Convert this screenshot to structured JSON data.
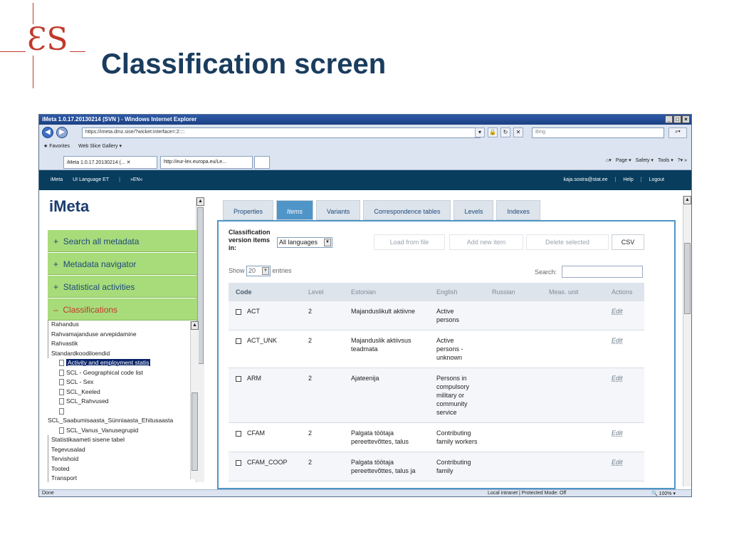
{
  "slide": {
    "title": "Classification screen"
  },
  "browser": {
    "window_title": "iMeta 1.0.17.20130214 (SVN ) - Windows Internet Explorer",
    "address": "https://imeta.dmz.sise/?wicket:interface=:2::::",
    "search_placeholder": "Bing",
    "favorites_label": "Favorites",
    "web_slice_label": "Web Slice Gallery ▾",
    "tabs": [
      "iMeta 1.0.17.20130214 (...",
      "http://eur-lex.europa.eu/Le..."
    ],
    "commands": [
      "Page ▾",
      "Safety ▾",
      "Tools ▾"
    ],
    "status_text": "Done",
    "zone_text": "Local intranet | Protected Mode: Off",
    "zoom": "100%"
  },
  "appbar": {
    "left": [
      "iMeta",
      "UI Language ET",
      "»EN«"
    ],
    "user": "kaja.sostra@stat.ee",
    "help": "Help",
    "logout": "Logout"
  },
  "sidebar": {
    "logo": "iMeta",
    "sections": [
      {
        "label": "Search all metadata",
        "symbol": "+"
      },
      {
        "label": "Metadata navigator",
        "symbol": "+"
      },
      {
        "label": "Statistical activities",
        "symbol": "+"
      },
      {
        "label": "Classifications",
        "symbol": "–"
      }
    ],
    "tree": [
      "Rahandus",
      "Rahvamajanduse arvepidamine",
      "Rahvastik",
      "Standardkoodiloendid",
      "Activity and employment statis",
      "SCL - Geographical code list",
      "SCL - Sex",
      "SCL_Keeled",
      "SCL_Rahvused",
      "",
      "SCL_Saabumisaasta_Sünniaasta_Ehitusaasta",
      "SCL_Vanus_Vanusegrupid",
      "Statistikaameti sisene tabel",
      "Tegevusalad",
      "Tervishoid",
      "Tooted",
      "Transport"
    ]
  },
  "tabs": [
    "Properties",
    "Items",
    "Variants",
    "Correspondence tables",
    "Levels",
    "Indexes"
  ],
  "active_tab": "Items",
  "toolbar": {
    "cv_label": "Classification version items in:",
    "language_value": "All languages",
    "load_label": "Load from file",
    "add_label": "Add new item",
    "delete_label": "Delete selected",
    "csv_label": "CSV",
    "show_label": "Show",
    "entries_value": "20",
    "entries_label": "entries",
    "search_label": "Search:"
  },
  "table": {
    "columns": [
      "Code",
      "Level",
      "Estonian",
      "English",
      "Russian",
      "Meas. unit",
      "Actions"
    ],
    "rows": [
      {
        "code": "ACT",
        "level": "2",
        "estonian": "Majanduslikult aktiivne",
        "english": "Active persons",
        "russian": "",
        "unit": "",
        "action": "Edit"
      },
      {
        "code": "ACT_UNK",
        "level": "2",
        "estonian": "Majanduslik aktiivsus teadmata",
        "english": "Active persons - unknown",
        "russian": "",
        "unit": "",
        "action": "Edit"
      },
      {
        "code": "ARM",
        "level": "2",
        "estonian": "Ajateenija",
        "english": "Persons in compulsory military or community service",
        "russian": "",
        "unit": "",
        "action": "Edit"
      },
      {
        "code": "CFAM",
        "level": "2",
        "estonian": "Palgata töötaja pereettevõttes, talus",
        "english": "Contributing family workers",
        "russian": "",
        "unit": "",
        "action": "Edit"
      },
      {
        "code": "CFAM_COOP",
        "level": "2",
        "estonian": "Palgata töötaja pereettevõttes, talus ja",
        "english": "Contributing family",
        "russian": "",
        "unit": "",
        "action": "Edit"
      }
    ]
  }
}
